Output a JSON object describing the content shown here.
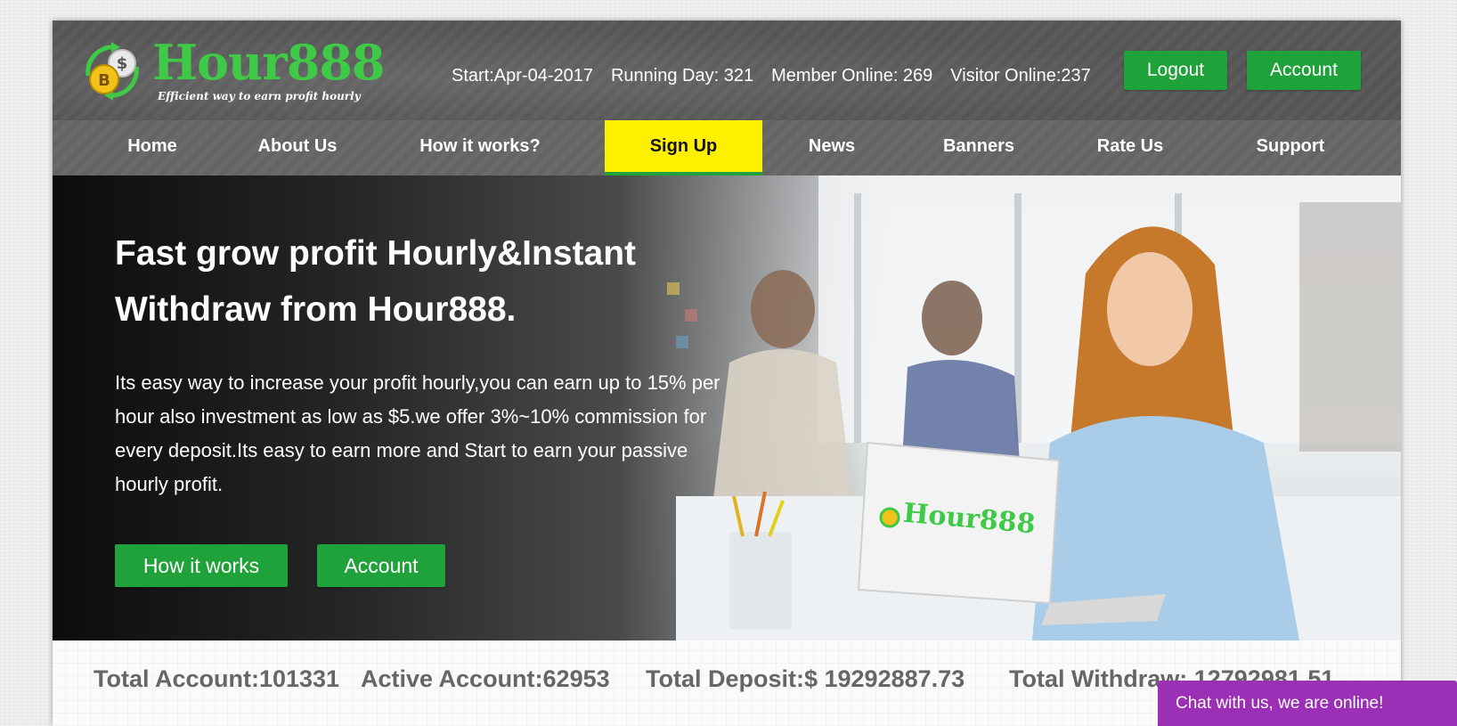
{
  "brand": {
    "name": "Hour888",
    "tagline": "Efficient way to earn profit hourly",
    "color": "#3ec946"
  },
  "header_stats": {
    "start": "Start:Apr-04-2017",
    "running_day": "Running Day: 321",
    "member_online": "Member Online: 269",
    "visitor_online": "Visitor Online:237"
  },
  "header_buttons": {
    "logout": "Logout",
    "account": "Account"
  },
  "nav": {
    "items": [
      "Home",
      "About Us",
      "How it works?",
      "Sign Up",
      "News",
      "Banners",
      "Rate Us",
      "Support"
    ],
    "active": "Sign Up"
  },
  "hero": {
    "title_line1": "Fast grow profit Hourly&Instant",
    "title_line2": "Withdraw from Hour888.",
    "text": "Its easy way to increase your profit hourly,you can earn up to 15% per hour also investment as low as $5.we offer 3%~10% commission for every deposit.Its easy to earn more and Start to earn your passive hourly profit.",
    "button_how": "How it works",
    "button_account": "Account",
    "laptop_logo": "Hour888"
  },
  "site_stats": {
    "total_account": "Total Account:101331",
    "active_account": "Active Account:62953",
    "total_deposit": "Total Deposit:$ 19292887.73",
    "total_withdraw": "Total Withdraw: 12792981.51"
  },
  "chat": {
    "label": "Chat with us, we are online!"
  },
  "colors": {
    "accent_green": "#1fa23a",
    "nav_active": "#fff000",
    "chat_purple": "#9b2fb5"
  }
}
